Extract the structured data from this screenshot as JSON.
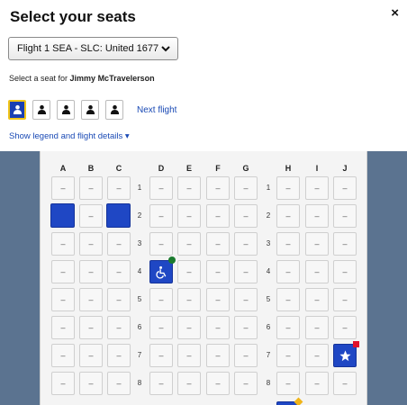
{
  "header": {
    "title": "Select your seats",
    "close_label": "×"
  },
  "flight_select": {
    "selected": "Flight 1 SEA - SLC: United 1677",
    "icon": "chevron-down-icon"
  },
  "passenger": {
    "prompt": "Select a seat for ",
    "name": "Jimmy McTravelerson"
  },
  "passengers": [
    {
      "icon": "person-icon",
      "active": true
    },
    {
      "icon": "person-icon",
      "active": false
    },
    {
      "icon": "person-icon",
      "active": false
    },
    {
      "icon": "person-icon",
      "active": false
    },
    {
      "icon": "person-icon",
      "active": false
    }
  ],
  "next_flight": "Next flight",
  "legend_link": "Show legend and flight details ▾",
  "colors": {
    "brand_blue": "#1f47c4",
    "link_blue": "#1a4ab5",
    "active_border": "#f0c419",
    "side_bg": "#5b7390",
    "status_green": "#1a7a2e",
    "status_red": "#e0102a",
    "status_yellow": "#f0b419"
  },
  "seatmap": {
    "columns": [
      "A",
      "B",
      "C",
      "D",
      "E",
      "F",
      "G",
      "H",
      "I",
      "J"
    ],
    "rows": [
      "1",
      "2",
      "3",
      "4",
      "5",
      "6",
      "7",
      "8"
    ],
    "empty_label": "–",
    "special_seats": {
      "2A": "selected",
      "2C": "selected",
      "4D": "accessible",
      "7J": "premium",
      "9H": "premium-partial"
    },
    "icons": {
      "accessible": "wheelchair-icon",
      "premium": "star-icon"
    }
  }
}
